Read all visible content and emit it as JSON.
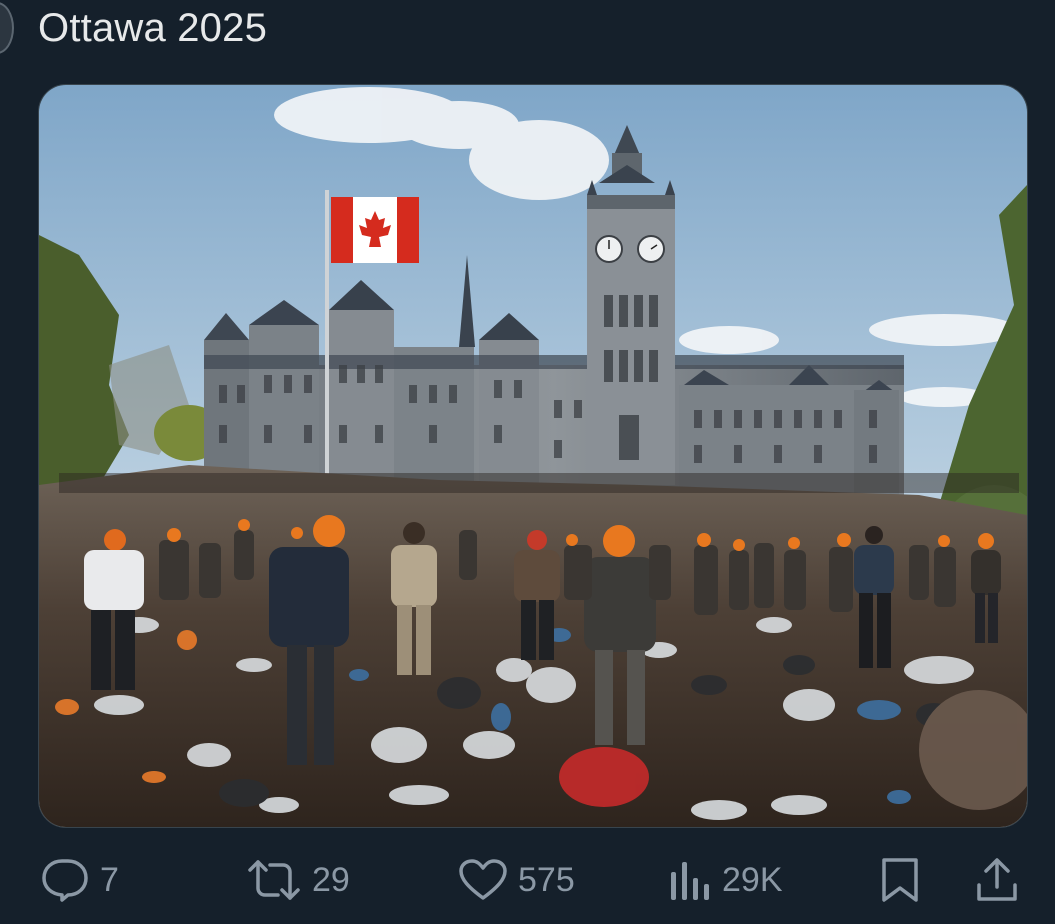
{
  "post": {
    "text": "Ottawa 2025"
  },
  "media": {
    "alt_icon": "image",
    "flag_colors": {
      "red": "#d52b1e",
      "white": "#ffffff"
    }
  },
  "actions": {
    "reply": {
      "icon": "reply-icon",
      "count": "7"
    },
    "repost": {
      "icon": "repost-icon",
      "count": "29"
    },
    "like": {
      "icon": "heart-icon",
      "count": "575"
    },
    "views": {
      "icon": "bar-chart-icon",
      "count": "29K"
    },
    "bookmark": {
      "icon": "bookmark-icon"
    },
    "share": {
      "icon": "share-icon"
    }
  },
  "colors": {
    "background": "#15202b",
    "text": "#e7e9ea",
    "muted": "#8b98a5",
    "border": "#38444d"
  }
}
